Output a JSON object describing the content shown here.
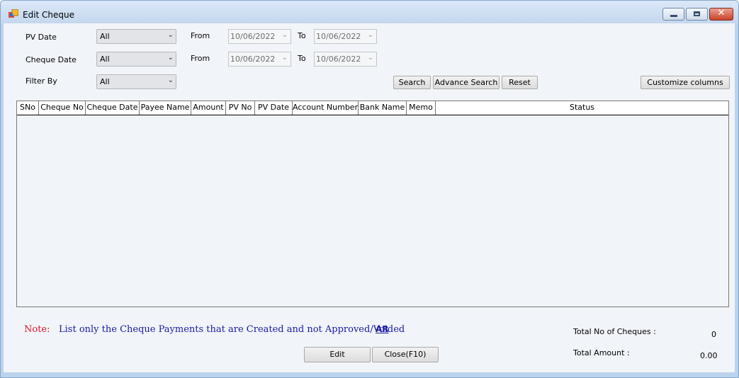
{
  "window": {
    "title": "Edit Cheque",
    "controls": {
      "minimize": "minimize",
      "maximize": "maximize",
      "close": "✕"
    }
  },
  "filters": {
    "pv_date": {
      "label": "PV Date",
      "value": "All",
      "from_label": "From",
      "from": "10/06/2022",
      "to_label": "To",
      "to": "10/06/2022"
    },
    "cheque_date": {
      "label": "Cheque Date",
      "value": "All",
      "from_label": "From",
      "from": "10/06/2022",
      "to_label": "To",
      "to": "10/06/2022"
    },
    "filter_by": {
      "label": "Filter By",
      "value": "All"
    }
  },
  "buttons": {
    "search": "Search",
    "advance_search": "Advance Search",
    "reset": "Reset",
    "customize": "Customize columns",
    "edit": "Edit",
    "close": "Close(F10)"
  },
  "grid": {
    "columns": [
      "SNo",
      "Cheque No",
      "Cheque Date",
      "Payee Name",
      "Amount",
      "PV No",
      "PV Date",
      "Account Number",
      "Bank Name",
      "Memo",
      "Status"
    ],
    "rows": []
  },
  "note": {
    "label": "Note:",
    "text": "List only the Cheque Payments that are Created and not Approved/Voided",
    "link": "AR"
  },
  "summary": {
    "total_cheques_label": "Total No of Cheques :",
    "total_cheques": "0",
    "total_amount_label": "Total Amount :",
    "total_amount": "0.00"
  },
  "icons": {
    "app": "app-window-icon",
    "dropdown": "chevron-down-icon"
  }
}
